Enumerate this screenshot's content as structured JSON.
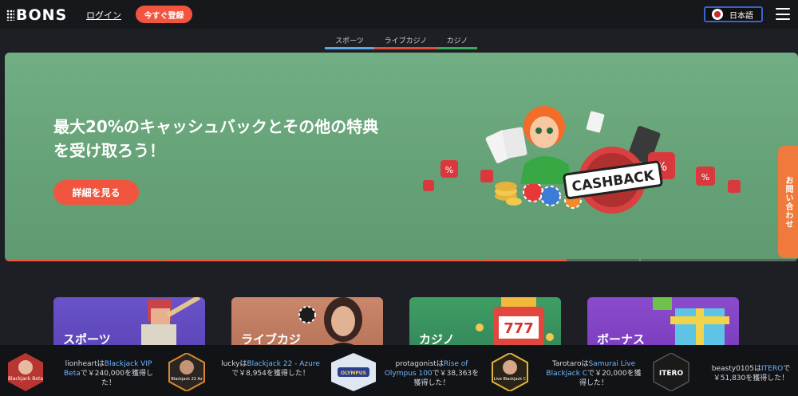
{
  "header": {
    "logo": "BONS",
    "login": "ログイン",
    "register": "今すぐ登録",
    "language": "日本語"
  },
  "tabs": [
    {
      "label": "スポーツ",
      "color": "#5ca6e6"
    },
    {
      "label": "ライブカジノ",
      "color": "#e24c3c"
    },
    {
      "label": "カジノ",
      "color": "#39a95a"
    }
  ],
  "banner": {
    "title": "最大20%のキャッシュバックとその他の特典を受け取ろう！",
    "button": "詳細を見る",
    "art_text": "CASHBACK",
    "slides_total": 5,
    "slide_progress": 0.55
  },
  "contact": "お問い合わせ",
  "categories": [
    {
      "label": "スポーツ"
    },
    {
      "label": "ライブカジ"
    },
    {
      "label": "カジノ"
    },
    {
      "label": "ボーナス"
    }
  ],
  "winners": [
    {
      "user": "lionheart",
      "mid": "は",
      "game": "Blackjack VIP Beta",
      "tail": "で￥240,000を獲得した！",
      "thumb": "Blackjack Beta"
    },
    {
      "user": "lucky",
      "mid": "は",
      "game": "Blackjack 22 - Azure",
      "tail": "で￥8,954を獲得した！",
      "thumb": "Blackjack 22 Az"
    },
    {
      "user": "protagonist",
      "mid": "は",
      "game": "Rise of Olympus 100",
      "tail": "で￥38,363を獲得した！",
      "thumb": "OLYMPUS"
    },
    {
      "user": "Tarotaro",
      "mid": "は",
      "game": "Samurai Live Blackjack C",
      "tail": "で￥20,000を獲得した！",
      "thumb": "Live Blackjack C"
    },
    {
      "user": "beasty0105",
      "mid": "は",
      "game": "ITERO",
      "tail": "で￥51,830を獲得した！",
      "thumb": "ITERO"
    }
  ],
  "colors": {
    "accent": "#f1553f",
    "banner": "#6aa77b",
    "background": "#1d1f24",
    "link": "#6fb6ff"
  }
}
